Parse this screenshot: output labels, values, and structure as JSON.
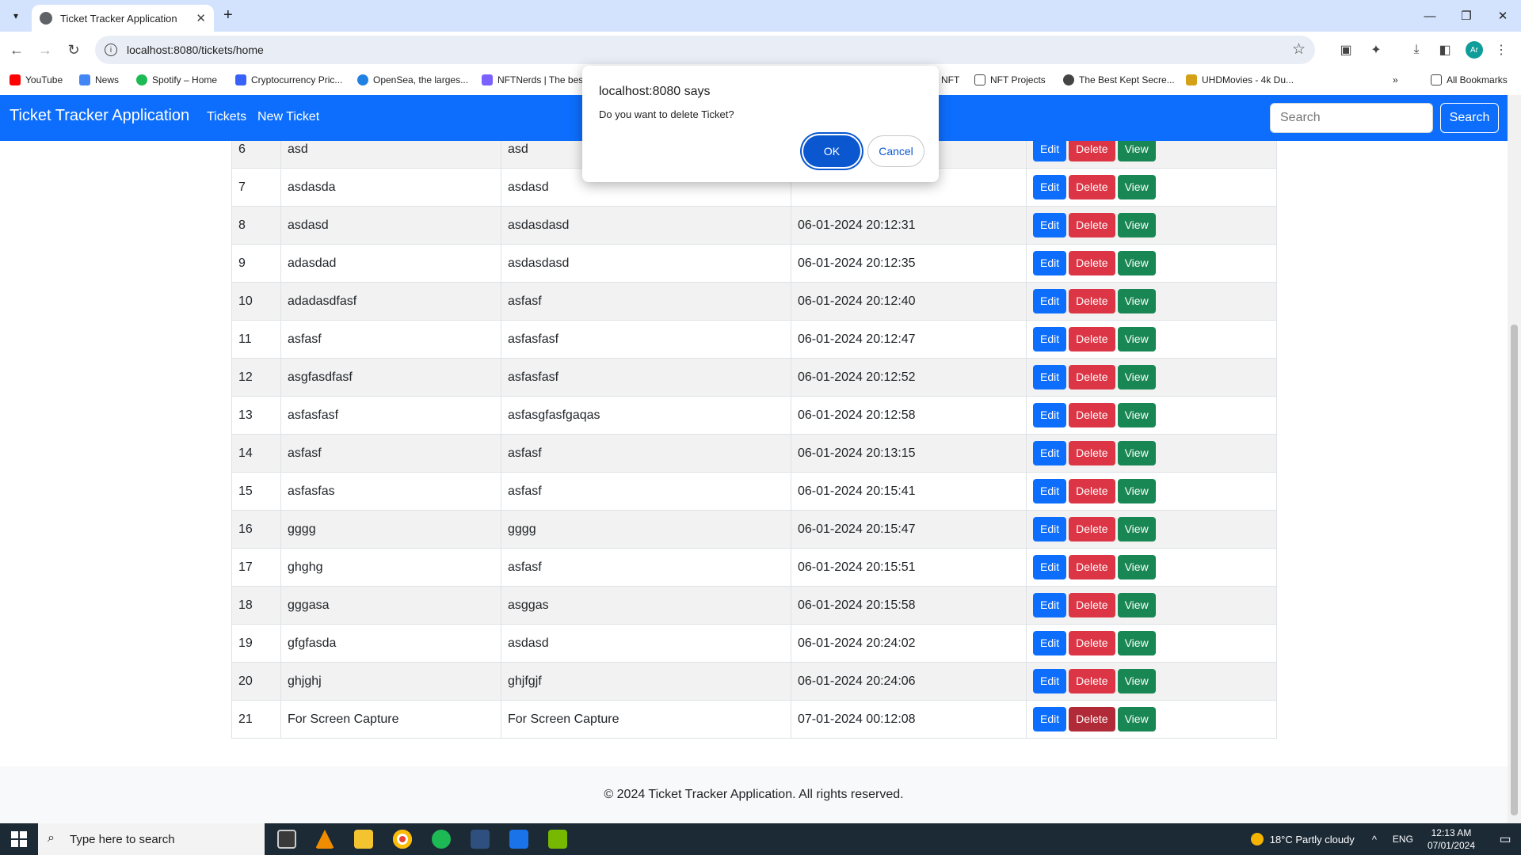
{
  "browser": {
    "tab_title": "Ticket Tracker Application",
    "url": "localhost:8080/tickets/home",
    "bookmarks": [
      "YouTube",
      "News",
      "Spotify – Home",
      "Cryptocurrency Pric...",
      "OpenSea, the larges...",
      "NFTNerds | The bes...",
      "NFT",
      "NFT Projects",
      "The Best Kept Secre...",
      "UHDMovies - 4k Du...",
      "All Bookmarks"
    ],
    "profile_initials": "Ar"
  },
  "navbar": {
    "brand": "Ticket Tracker Application",
    "links": [
      "Tickets",
      "New Ticket"
    ],
    "search_placeholder": "Search",
    "search_button": "Search"
  },
  "table": {
    "actions": {
      "edit": "Edit",
      "delete": "Delete",
      "view": "View"
    },
    "rows": [
      {
        "id": "6",
        "title": "asd",
        "description": "asd",
        "created": ""
      },
      {
        "id": "7",
        "title": "asdasda",
        "description": "asdasd",
        "created": ""
      },
      {
        "id": "8",
        "title": "asdasd",
        "description": "asdasdasd",
        "created": "06-01-2024 20:12:31"
      },
      {
        "id": "9",
        "title": "adasdad",
        "description": "asdasdasd",
        "created": "06-01-2024 20:12:35"
      },
      {
        "id": "10",
        "title": "adadasdfasf",
        "description": "asfasf",
        "created": "06-01-2024 20:12:40"
      },
      {
        "id": "11",
        "title": "asfasf",
        "description": "asfasfasf",
        "created": "06-01-2024 20:12:47"
      },
      {
        "id": "12",
        "title": "asgfasdfasf",
        "description": "asfasfasf",
        "created": "06-01-2024 20:12:52"
      },
      {
        "id": "13",
        "title": "asfasfasf",
        "description": "asfasgfasfgaqas",
        "created": "06-01-2024 20:12:58"
      },
      {
        "id": "14",
        "title": "asfasf",
        "description": "asfasf",
        "created": "06-01-2024 20:13:15"
      },
      {
        "id": "15",
        "title": "asfasfas",
        "description": "asfasf",
        "created": "06-01-2024 20:15:41"
      },
      {
        "id": "16",
        "title": "gggg",
        "description": "gggg",
        "created": "06-01-2024 20:15:47"
      },
      {
        "id": "17",
        "title": "ghghg",
        "description": "asfasf",
        "created": "06-01-2024 20:15:51"
      },
      {
        "id": "18",
        "title": "gggasa",
        "description": "asggas",
        "created": "06-01-2024 20:15:58"
      },
      {
        "id": "19",
        "title": "gfgfasda",
        "description": "asdasd",
        "created": "06-01-2024 20:24:02"
      },
      {
        "id": "20",
        "title": "ghjghj",
        "description": "ghjfgjf",
        "created": "06-01-2024 20:24:06"
      },
      {
        "id": "21",
        "title": "For Screen Capture",
        "description": "For Screen Capture",
        "created": "07-01-2024 00:12:08"
      }
    ]
  },
  "footer": {
    "text": "© 2024 Ticket Tracker Application. All rights reserved."
  },
  "dialog": {
    "title": "localhost:8080 says",
    "message": "Do you want to delete Ticket?",
    "ok": "OK",
    "cancel": "Cancel"
  },
  "taskbar": {
    "search_placeholder": "Type here to search",
    "weather": "18°C  Partly cloudy",
    "language": "ENG",
    "time": "12:13 AM",
    "date": "07/01/2024"
  },
  "colors": {
    "primary": "#0d6efd",
    "danger": "#dc3545",
    "success": "#198754"
  }
}
